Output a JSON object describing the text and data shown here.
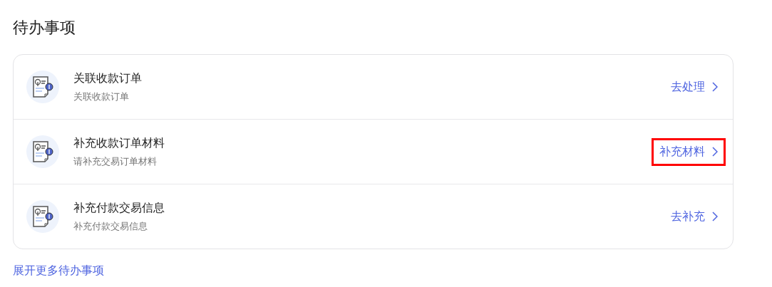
{
  "title": "待办事项",
  "items": [
    {
      "title": "关联收款订单",
      "subtitle": "关联收款订单",
      "action": "去处理",
      "highlighted": false
    },
    {
      "title": "补充收款订单材料",
      "subtitle": "请补充交易订单材料",
      "action": "补充材料",
      "highlighted": true
    },
    {
      "title": "补充付款交易信息",
      "subtitle": "补充付款交易信息",
      "action": "去补充",
      "highlighted": false
    }
  ],
  "more_link": "展开更多待办事项"
}
